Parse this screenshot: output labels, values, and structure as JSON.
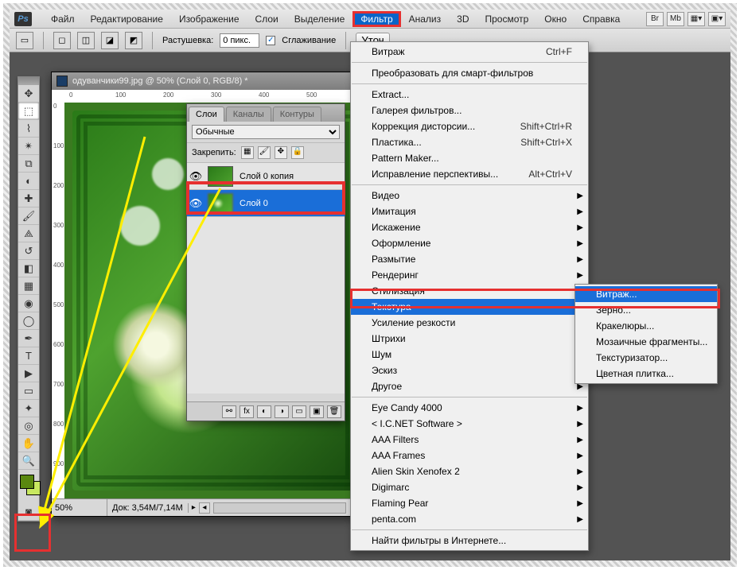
{
  "menubar": {
    "items": [
      "Файл",
      "Редактирование",
      "Изображение",
      "Слои",
      "Выделение",
      "Фильтр",
      "Анализ",
      "3D",
      "Просмотр",
      "Окно",
      "Справка"
    ],
    "active_index": 5,
    "right_buttons": [
      "Br",
      "Mb"
    ]
  },
  "optbar": {
    "feather_label": "Растушевка:",
    "feather_value": "0 пикс.",
    "smooth_label": "Сглаживание",
    "refine_label": "Уточ"
  },
  "document": {
    "title": "одуванчики99.jpg @ 50% (Слой 0, RGB/8) *",
    "ruler_h": [
      "0",
      "100",
      "200",
      "300",
      "400",
      "500"
    ],
    "ruler_v": [
      "0",
      "100",
      "200",
      "300",
      "400",
      "500",
      "600",
      "700",
      "800",
      "900"
    ],
    "zoom": "50%",
    "docsize": "Док: 3,54M/7,14M"
  },
  "layers_panel": {
    "tabs": [
      "Слои",
      "Каналы",
      "Контуры"
    ],
    "blend_mode": "Обычные",
    "lock_label": "Закрепить:",
    "layers": [
      {
        "name": "Слой 0 копия",
        "selected": false
      },
      {
        "name": "Слой 0",
        "selected": true
      }
    ]
  },
  "filter_menu": {
    "top_item": {
      "label": "Витраж",
      "shortcut": "Ctrl+F"
    },
    "groups": [
      [
        {
          "label": "Преобразовать для смарт-фильтров"
        }
      ],
      [
        {
          "label": "Extract..."
        },
        {
          "label": "Галерея фильтров..."
        },
        {
          "label": "Коррекция дисторсии...",
          "shortcut": "Shift+Ctrl+R"
        },
        {
          "label": "Пластика...",
          "shortcut": "Shift+Ctrl+X"
        },
        {
          "label": "Pattern Maker..."
        },
        {
          "label": "Исправление перспективы...",
          "shortcut": "Alt+Ctrl+V"
        }
      ],
      [
        {
          "label": "Видео",
          "sub": true
        },
        {
          "label": "Имитация",
          "sub": true
        },
        {
          "label": "Искажение",
          "sub": true
        },
        {
          "label": "Оформление",
          "sub": true
        },
        {
          "label": "Размытие",
          "sub": true
        },
        {
          "label": "Рендеринг",
          "sub": true
        },
        {
          "label": "Стилизация",
          "sub": true
        },
        {
          "label": "Текстура",
          "sub": true,
          "hover": true
        },
        {
          "label": "Усиление резкости",
          "sub": true
        },
        {
          "label": "Штрихи",
          "sub": true
        },
        {
          "label": "Шум",
          "sub": true
        },
        {
          "label": "Эскиз",
          "sub": true
        },
        {
          "label": "Другое",
          "sub": true
        }
      ],
      [
        {
          "label": "Eye Candy 4000",
          "sub": true
        },
        {
          "label": "< I.C.NET Software >",
          "sub": true
        },
        {
          "label": "AAA Filters",
          "sub": true
        },
        {
          "label": "AAA Frames",
          "sub": true
        },
        {
          "label": "Alien Skin Xenofex 2",
          "sub": true
        },
        {
          "label": "Digimarc",
          "sub": true
        },
        {
          "label": "Flaming Pear",
          "sub": true
        },
        {
          "label": "penta.com",
          "sub": true
        }
      ],
      [
        {
          "label": "Найти фильтры в Интернете..."
        }
      ]
    ]
  },
  "sub_menu": {
    "items": [
      {
        "label": "Витраж...",
        "hover": true
      },
      {
        "label": "Зерно..."
      },
      {
        "label": "Кракелюры..."
      },
      {
        "label": "Мозаичные фрагменты..."
      },
      {
        "label": "Текстуризатор..."
      },
      {
        "label": "Цветная плитка..."
      }
    ]
  },
  "tools": [
    "▭",
    "⬚",
    "✥",
    "⌖",
    "✂",
    "👁",
    "✎",
    "🖌",
    "▟",
    "✑",
    "⧉",
    "◔",
    "🅰",
    "T",
    "▶",
    "⬡",
    "✋",
    "🔍"
  ]
}
